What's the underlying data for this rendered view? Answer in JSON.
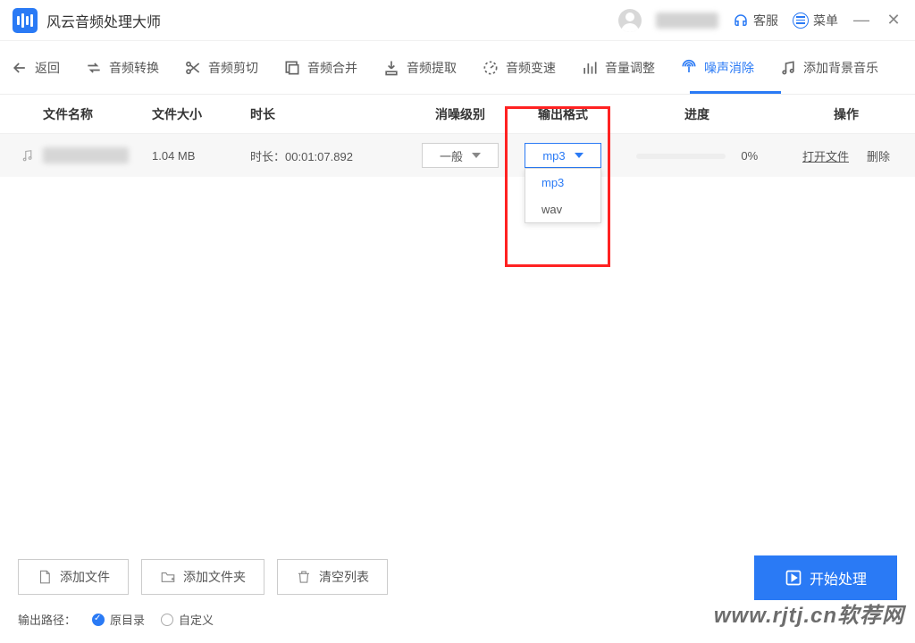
{
  "app": {
    "title": "风云音频处理大师"
  },
  "titlebar": {
    "support": "客服",
    "menu": "菜单"
  },
  "toolbar": {
    "back": "返回",
    "convert": "音频转换",
    "cut": "音频剪切",
    "merge": "音频合并",
    "extract": "音频提取",
    "speed": "音频变速",
    "volume": "音量调整",
    "denoise": "噪声消除",
    "bgm": "添加背景音乐"
  },
  "columns": {
    "name": "文件名称",
    "size": "文件大小",
    "duration": "时长",
    "noise": "消噪级别",
    "format": "输出格式",
    "progress": "进度",
    "ops": "操作"
  },
  "row": {
    "size": "1.04 MB",
    "dur_label": "时长：",
    "dur_value": "00:01:07.892",
    "noise_level": "一般",
    "format_selected": "mp3",
    "format_options": [
      "mp3",
      "wav"
    ],
    "progress": "0%",
    "open": "打开文件",
    "delete": "删除"
  },
  "bottom": {
    "add_file": "添加文件",
    "add_folder": "添加文件夹",
    "clear": "清空列表",
    "start": "开始处理",
    "path_label": "输出路径：",
    "orig_dir": "原目录",
    "custom": "自定义"
  },
  "watermark": "www.rjtj.cn软荐网"
}
